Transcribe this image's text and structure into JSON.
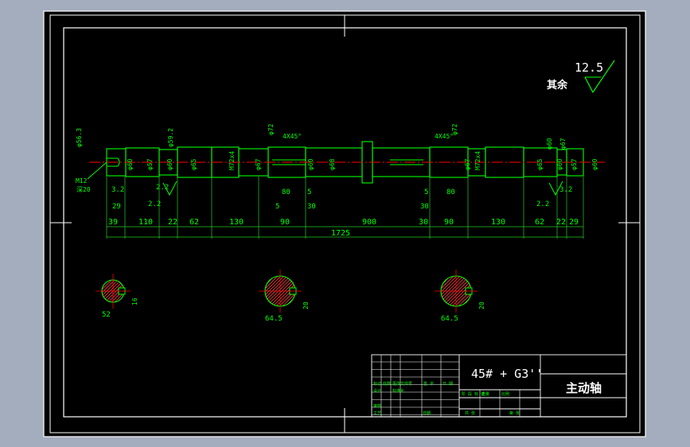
{
  "colors": {
    "window_bg": "#a3adbd",
    "canvas_bg": "#000000",
    "frame": "#ffffff",
    "outline": "#00ff00",
    "dimension": "#22cc22",
    "center_line": "#ff0000",
    "hatch": "#ff4040",
    "accent": "#ffff00"
  },
  "roughness": {
    "value": "12.5",
    "note": "其余"
  },
  "shaft": {
    "lengths": [
      "39",
      "110",
      "22",
      "62",
      "130",
      "90",
      "900",
      "30",
      "90",
      "130",
      "62",
      "22",
      "29"
    ],
    "total_length": "1725",
    "upper_lengths": [
      "29",
      "3.2",
      "80",
      "5",
      "5",
      "30",
      "30",
      "5",
      "80",
      "3.2"
    ],
    "diameters": [
      "φ60",
      "φ57",
      "φ60",
      "φ65",
      "M72x4",
      "φ67",
      "φ60",
      "φ68",
      "φ65",
      "M72x4",
      "φ67",
      "φ60",
      "φ57",
      "φ60"
    ],
    "top_labels": [
      "φ56.3",
      "φ59.2",
      "φ72",
      "4X45°",
      "4X45°",
      "φ72",
      "φ60",
      "φ67"
    ],
    "side_labels": [
      "M12",
      "深20"
    ],
    "groove_labels": [
      "2.2",
      "2.2",
      "2.2"
    ]
  },
  "sections": [
    {
      "name": "section-a",
      "width": "16",
      "depth": "52"
    },
    {
      "name": "section-b",
      "width": "20",
      "depth": "64.5"
    },
    {
      "name": "section-c",
      "width": "20",
      "depth": "64.5"
    }
  ],
  "title_block": {
    "material": "45# + G3''",
    "part_name": "主动轴",
    "cells": [
      "标记",
      "处数",
      "更改文件号",
      "签 字",
      "日 期",
      "设计",
      "标准化",
      "审核",
      "工艺",
      "日期",
      "阶 段 标 记",
      "重量",
      "比例",
      "共 张",
      "第 张"
    ]
  }
}
